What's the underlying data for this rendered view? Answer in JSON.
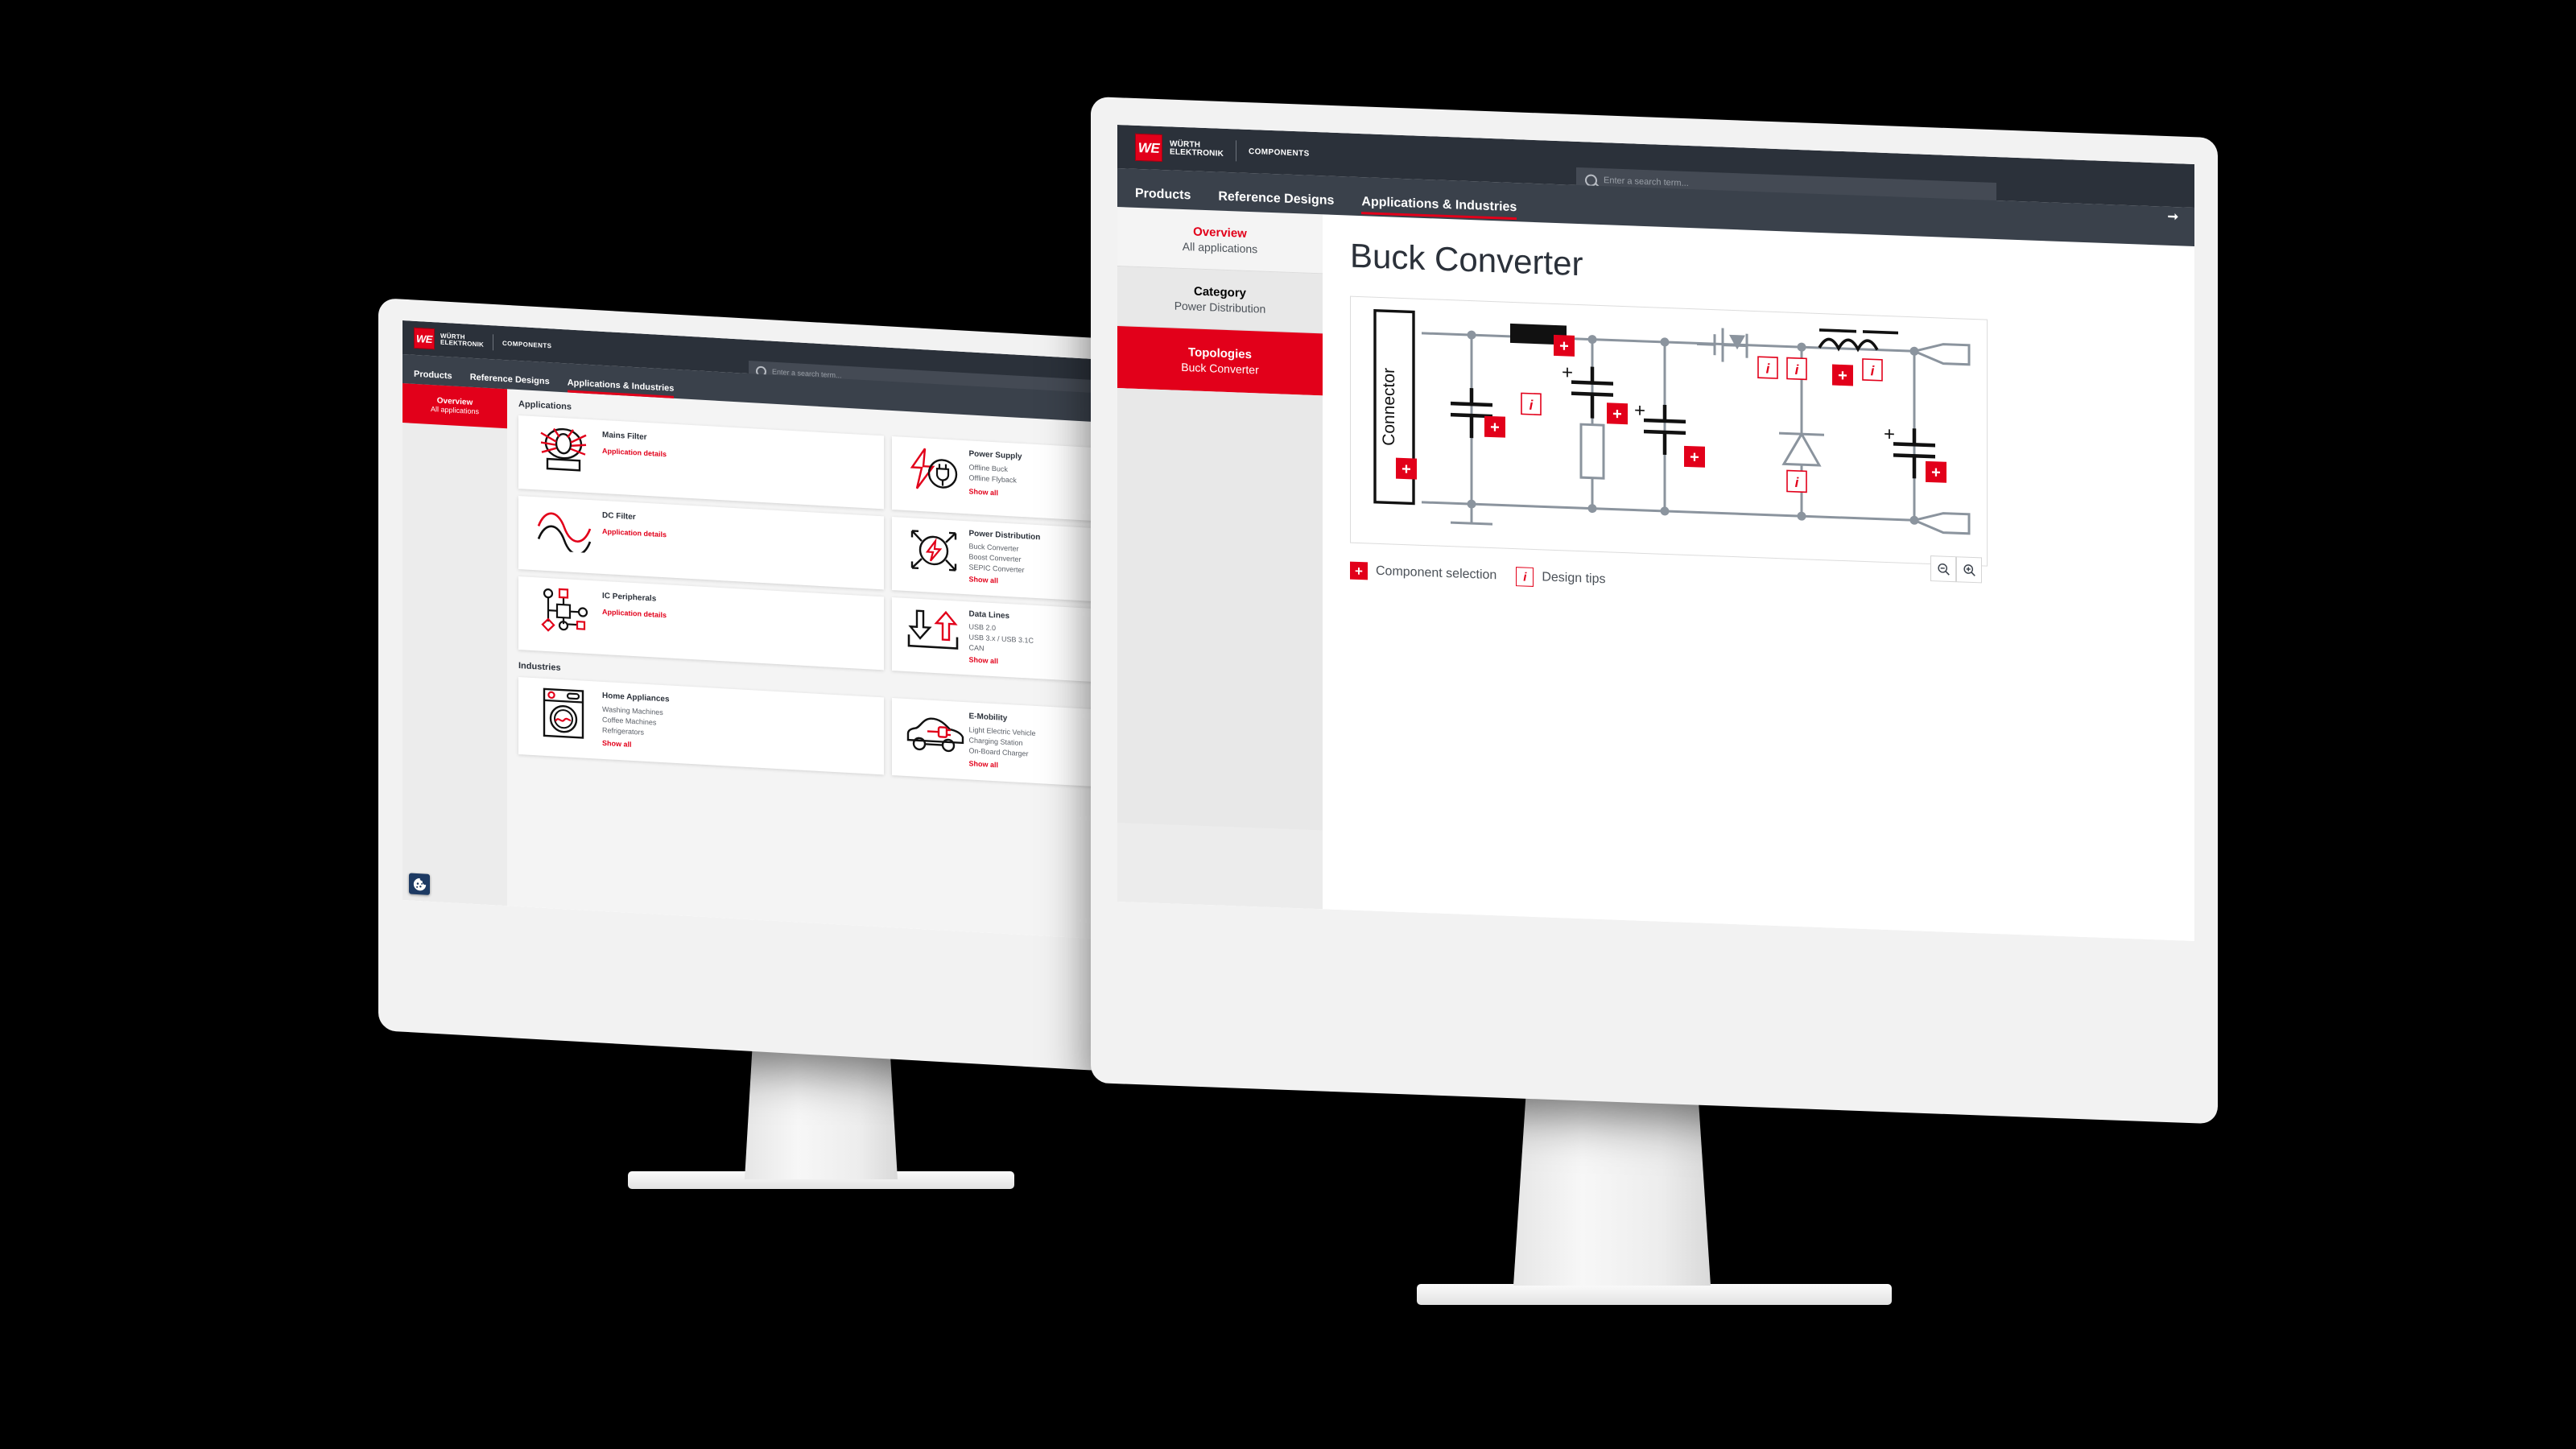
{
  "brand": {
    "logo_mark": "WE",
    "logo_line1": "WÜRTH",
    "logo_line2": "ELEKTRONIK",
    "logo_suffix": "COMPONENTS",
    "accent_red": "#e2001a",
    "dark_header": "#2b313a",
    "nav_bg": "#3a414b"
  },
  "search": {
    "placeholder": "Enter a search term...",
    "icon": "search-icon",
    "submit_icon": "arrow-right-icon"
  },
  "nav": {
    "items": [
      {
        "label": "Products",
        "active": false
      },
      {
        "label": "Reference Designs",
        "active": false
      },
      {
        "label": "Applications & Industries",
        "active": true
      }
    ]
  },
  "front_window": {
    "sidebar": [
      {
        "title": "Overview",
        "subtitle": "All applications",
        "state": "overview"
      },
      {
        "title": "Category",
        "subtitle": "Power Distribution",
        "state": "normal"
      },
      {
        "title": "Topologies",
        "subtitle": "Buck Converter",
        "state": "active"
      }
    ],
    "page_title": "Buck Converter",
    "diagram": {
      "connector_label": "Connector",
      "plus_markers": 7,
      "info_markers": 5
    },
    "legend": [
      {
        "icon": "plus-badge-icon",
        "label": "Component selection"
      },
      {
        "icon": "info-badge-icon",
        "label": "Design tips"
      }
    ],
    "zoom_controls": [
      {
        "name": "zoom-out-button",
        "glyph": "−"
      },
      {
        "name": "zoom-in-button",
        "glyph": "+"
      }
    ]
  },
  "rear_window": {
    "sidebar": [
      {
        "title": "Overview",
        "subtitle": "All applications",
        "state": "active"
      }
    ],
    "sections": [
      {
        "title": "Applications",
        "left_cards": [
          {
            "title": "Mains Filter",
            "icon": "common-mode-choke-icon",
            "links": [],
            "detail_link": "Application details"
          },
          {
            "title": "DC Filter",
            "icon": "dc-filter-waveform-icon",
            "links": [],
            "detail_link": "Application details"
          },
          {
            "title": "IC Peripherals",
            "icon": "ic-peripherals-icon",
            "links": [],
            "detail_link": "Application details"
          }
        ],
        "right_cards": [
          {
            "title": "Power Supply",
            "icon": "power-plug-bolt-icon",
            "links": [
              "Offline Buck",
              "Offline Flyback"
            ],
            "show_all": "Show all"
          },
          {
            "title": "Power Distribution",
            "icon": "power-distribution-icon",
            "links": [
              "Buck Converter",
              "Boost Converter",
              "SEPIC Converter"
            ],
            "show_all": "Show all"
          },
          {
            "title": "Data Lines",
            "icon": "data-transfer-arrows-icon",
            "links": [
              "USB 2.0",
              "USB 3.x / USB 3.1C",
              "CAN"
            ],
            "show_all": "Show all"
          }
        ]
      },
      {
        "title": "Industries",
        "left_cards": [
          {
            "title": "Home Appliances",
            "icon": "washing-machine-icon",
            "links": [
              "Washing Machines",
              "Coffee Machines",
              "Refrigerators"
            ],
            "show_all": "Show all"
          }
        ],
        "right_cards": [
          {
            "title": "E-Mobility",
            "icon": "electric-car-icon",
            "links": [
              "Light Electric Vehicle",
              "Charging Station",
              "On-Board Charger"
            ],
            "show_all": "Show all"
          }
        ]
      }
    ],
    "cookie_badge": {
      "icon": "cookie-settings-icon"
    }
  }
}
